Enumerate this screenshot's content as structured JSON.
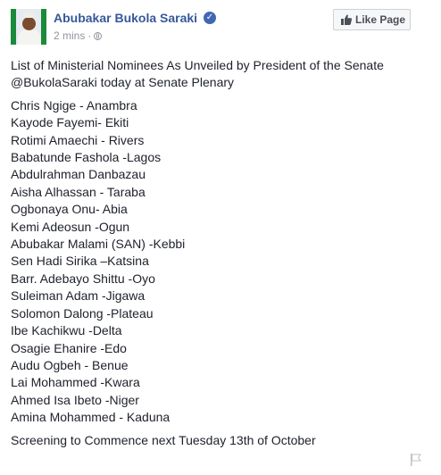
{
  "post": {
    "author": "Abubakar Bukola Saraki",
    "timestamp": "2 mins",
    "separator": "·",
    "verified_mark": "✓",
    "like_page_label": "Like Page",
    "intro_lines": [
      "List of Ministerial Nominees As Unveiled by President of the Senate",
      "@BukolaSaraki today at Senate Plenary"
    ],
    "nominees": [
      "Chris Ngige - Anambra",
      "Kayode Fayemi- Ekiti",
      "Rotimi Amaechi - Rivers",
      "Babatunde Fashola -Lagos",
      "Abdulrahman Danbazau",
      "Aisha Alhassan - Taraba",
      "Ogbonaya Onu- Abia",
      "Kemi Adeosun -Ogun",
      "Abubakar Malami (SAN) -Kebbi",
      "Sen Hadi Sirika –Katsina",
      "Barr. Adebayo Shittu -Oyo",
      "Suleiman Adam -Jigawa",
      "Solomon Dalong -Plateau",
      "Ibe Kachikwu -Delta",
      "Osagie Ehanire -Edo",
      "Audu Ogbeh - Benue",
      "Lai Mohammed -Kwara",
      "Ahmed Isa Ibeto -Niger",
      "Amina Mohammed - Kaduna"
    ],
    "closing": "Screening to Commence next Tuesday 13th of October"
  },
  "icons": {
    "verified": "verified-badge-icon",
    "audience": "globe-icon",
    "like": "thumbs-up-icon",
    "report": "flag-icon"
  },
  "colors": {
    "name": "#365899",
    "meta": "#90949c",
    "text": "#1d2129",
    "button_bg": "#f6f7f9",
    "button_border": "#ced0d4",
    "verified": "#4267b2"
  }
}
